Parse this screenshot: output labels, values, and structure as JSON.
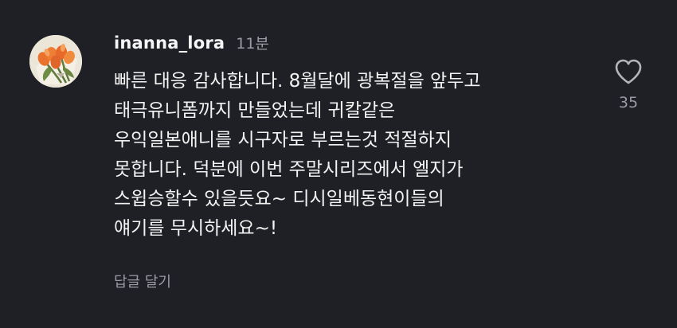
{
  "comment": {
    "username": "inanna_lora",
    "timestamp": "11분",
    "lines": [
      "빠른 대응 감사합니다. 8월달에 광복절을 앞두고",
      "태극유니폼까지 만들었는데 귀칼같은",
      "우익일본애니를 시구자로 부르는것 적절하지",
      "못합니다. 덕분에 이번 주말시리즈에서 엘지가",
      "스윕승할수 있을듯요~ 디시일베동현이들의",
      "얘기를 무시하세요~!"
    ],
    "reply_label": "답글 달기",
    "like_count": "35"
  },
  "icons": {
    "like": "heart-outline-icon",
    "avatar": "tulip-bouquet-photo"
  },
  "colors": {
    "background": "#1f2025",
    "text_primary": "#f2f2f2",
    "text_secondary": "#9a9ca3"
  }
}
